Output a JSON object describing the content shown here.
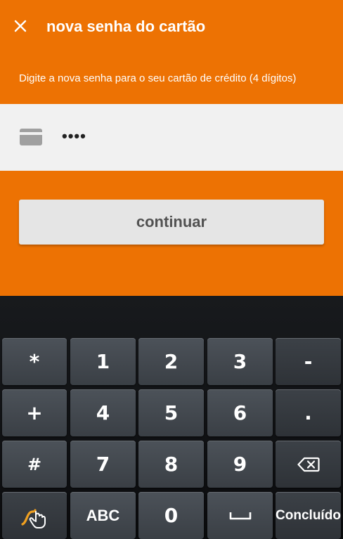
{
  "header": {
    "title": "nova senha do cartão",
    "subtitle": "Digite a nova senha para o seu cartão de crédito (4 dígitos)"
  },
  "password_field": {
    "value": "••••"
  },
  "continue_button": {
    "label": "continuar"
  },
  "keyboard": {
    "row1": [
      "*",
      "1",
      "2",
      "3",
      "-"
    ],
    "row2": [
      "+",
      "4",
      "5",
      "6",
      "."
    ],
    "row3": [
      "#",
      "7",
      "8",
      "9"
    ],
    "row4_abc": "ABC",
    "row4_zero": "0",
    "row4_done": "Concluído"
  },
  "colors": {
    "accent": "#ed7203",
    "field_bg": "#f1f1f1",
    "button_bg": "#e5e5e5"
  }
}
